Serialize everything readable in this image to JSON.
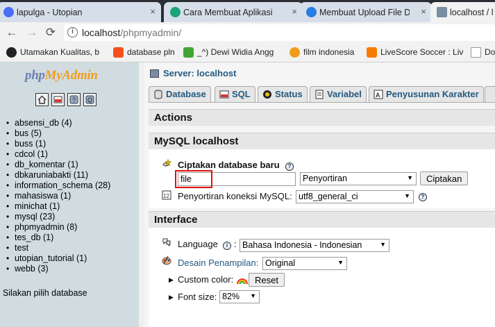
{
  "browser": {
    "tabs": [
      {
        "title": "lapulga - Utopian",
        "favicon_color": "#4a6cf7",
        "active": false
      },
      {
        "title": "Cara Membuat Aplikasi W",
        "favicon_color": "#1aa57a",
        "active": false
      },
      {
        "title": "Membuat Upload File De",
        "favicon_color": "#2a7de1",
        "active": false
      },
      {
        "title": "localhost / l",
        "favicon_color": "#7a8ea3",
        "active": true
      }
    ],
    "close_glyph": "×",
    "address": {
      "host": "localhost",
      "path": "/phpmyadmin/",
      "info_glyph": "i"
    },
    "nav": {
      "back": "←",
      "forward": "→",
      "reload": "⟳"
    },
    "bookmarks": [
      {
        "label": "Utamakan Kualitas, b",
        "icon_color": "#222222"
      },
      {
        "label": "database pln",
        "icon_color": "#f4511e"
      },
      {
        "label": "_^) Dewi Widia Angg",
        "icon_color": "#3fa535"
      },
      {
        "label": "film indonesia",
        "icon_color": "#f29c1b"
      },
      {
        "label": "LiveScore Soccer : Liv",
        "icon_color": "#f57c00"
      },
      {
        "label": "Do",
        "icon_color": "#999999"
      }
    ]
  },
  "left": {
    "logo": {
      "php": "php",
      "my": "My",
      "admin": "Admin"
    },
    "icons": [
      "home-icon",
      "sql-icon",
      "docs-icon",
      "query-window-icon"
    ],
    "databases": [
      "absensi_db (4)",
      "bus (5)",
      "buss (1)",
      "cdcol (1)",
      "db_komentar (1)",
      "dbkaruniabakti (11)",
      "information_schema (28)",
      "mahasiswa (1)",
      "minichat (1)",
      "mysql (23)",
      "phpmyadmin (8)",
      "tes_db (1)",
      "test",
      "utopian_tutorial (1)",
      "webb (3)"
    ],
    "pick_db": "Silakan pilih database"
  },
  "main": {
    "server": "Server: localhost",
    "tabs": [
      "Database",
      "SQL",
      "Status",
      "Variabel",
      "Penyusunan Karakter"
    ],
    "actions_title": "Actions",
    "mysql_title": "MySQL localhost",
    "create_db_label": "Ciptakan database baru",
    "create_db_value": "file",
    "collation_placeholder": "Penyortiran",
    "create_button": "Ciptakan",
    "conn_collation_label": "Penyortiran koneksi MySQL:",
    "conn_collation_value": "utf8_general_ci",
    "interface_title": "Interface",
    "language_label": "Language",
    "language_value": "Bahasa Indonesia - Indonesian",
    "theme_label": "Desain Penampilan:",
    "theme_value": "Original",
    "custom_color_label": "Custom color:",
    "reset_button": "Reset",
    "font_size_label": "Font size:",
    "font_size_value": "82%",
    "help_glyph": "?",
    "info_glyph": "i",
    "separator": ":"
  }
}
